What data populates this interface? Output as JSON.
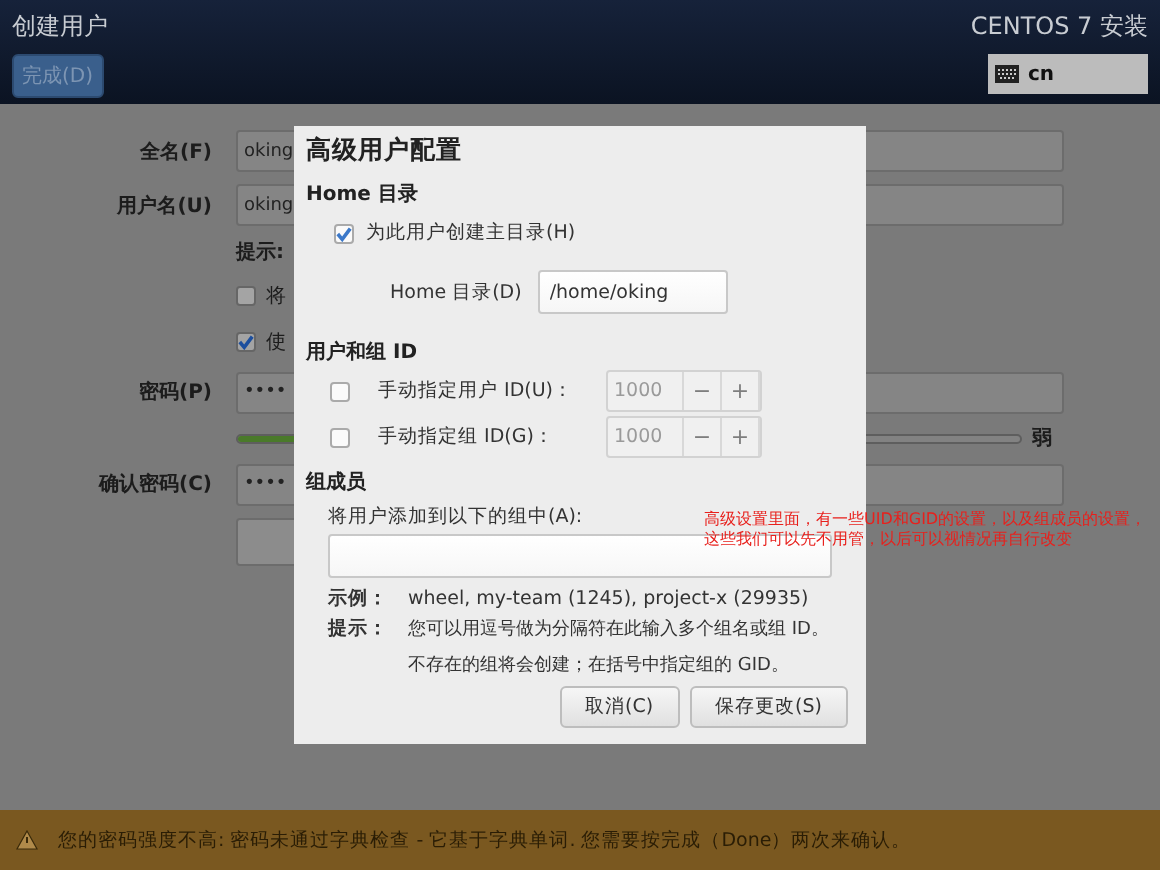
{
  "header": {
    "title": "创建用户",
    "done_button": "完成(D)",
    "product": "CENTOS 7 安装",
    "keyboard": "cn"
  },
  "form": {
    "fields": [
      {
        "label": "全名(F)",
        "value": "oking"
      },
      {
        "label": "用户名(U)",
        "value": "oking"
      }
    ],
    "hint_label": "提示:",
    "checkboxes": [
      {
        "label": "将",
        "checked": false
      },
      {
        "label": "使",
        "checked": true
      }
    ],
    "password": {
      "label": "密码(P)",
      "value": "••••"
    },
    "strength": {
      "level": 0.25,
      "reading": "弱"
    },
    "confirm": {
      "label": "确认密码(C)",
      "value": "••••"
    }
  },
  "dialog": {
    "title": "高级用户配置",
    "home": {
      "heading": "Home 目录",
      "create": {
        "label": "为此用户创建主目录(H)",
        "checked": true
      },
      "dir_label": "Home 目录(D)",
      "dir_value": "/home/oking"
    },
    "ids": {
      "heading": "用户和组 ID",
      "rows": [
        {
          "label": "手动指定用户 ID(U)：",
          "checked": false,
          "value": "1000",
          "minus": "−",
          "plus": "+"
        },
        {
          "label": "手动指定组 ID(G)：",
          "checked": false,
          "value": "1000",
          "minus": "−",
          "plus": "+"
        }
      ]
    },
    "groups": {
      "heading": "组成员",
      "label": "将用户添加到以下的组中(A):",
      "example_label": "示例：",
      "example_text": "wheel, my-team (1245), project-x (29935)",
      "hint_label": "提示：",
      "hint_lines": [
        "您可以用逗号做为分隔符在此输入多个组名或组 ID。",
        "不存在的组将会创建；在括号中指定组的 GID。"
      ]
    },
    "buttons": [
      "取消(C)",
      "保存更改(S)"
    ]
  },
  "annotation": "高级设置里面，有一些UID和GID的设置，以及组成员的设置，这些我们可以先不用管，以后可以视情况再自行改变",
  "warning": "您的密码强度不高: 密码未通过字典检查 - 它基于字典单词. 您需要按完成（Done）两次来确认。"
}
